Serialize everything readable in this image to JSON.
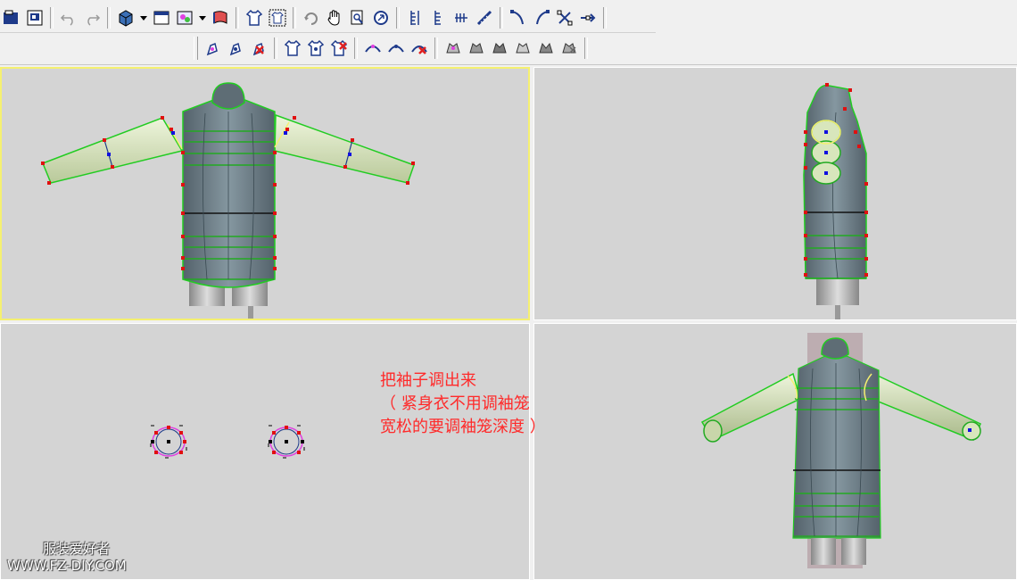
{
  "toolbar": {
    "row1": [
      "open-icon",
      "save-icon",
      "undo-icon",
      "redo-icon",
      "cube-view-icon",
      "dropdown-arrow-icon",
      "single-view-icon",
      "multi-view-icon",
      "dropdown-arrow-icon",
      "flag-icon",
      "shirt-icon",
      "shirt-frame-icon",
      "rotate-icon",
      "hand-pan-icon",
      "zoom-icon",
      "orbit-icon",
      "ruler-vertical-icon",
      "ruler-vertical-2-icon",
      "ruler-horizontal-icon",
      "measure-tape-icon",
      "curve-left-icon",
      "curve-right-icon",
      "node-edit-icon",
      "arrow-node-icon"
    ],
    "row2": [
      "pen-add-icon",
      "pen-edit-icon",
      "pen-delete-icon",
      "shirt-add-icon",
      "shirt-edit-icon",
      "shirt-delete-icon",
      "collar-add-icon",
      "collar-edit-icon",
      "collar-delete-icon",
      "neck-icon-1",
      "neck-icon-2",
      "neck-icon-3",
      "neck-icon-4",
      "neck-icon-5",
      "neck-icon-6"
    ]
  },
  "annotation": {
    "line1": "把袖子调出来",
    "line2": "（ 紧身衣不用调袖笼",
    "line3": "宽松的要调袖笼深度 ）"
  },
  "watermark": {
    "cn": "服装爱好者",
    "url": "WWW.FZ-DIY.COM"
  },
  "colors": {
    "viewport_bg": "#d4d4d4",
    "active_border": "#f5f070",
    "annotation": "#ff2a2a",
    "outline": "#22cc22",
    "body": "#6f7f88",
    "sleeve": "#d8e6bc"
  }
}
